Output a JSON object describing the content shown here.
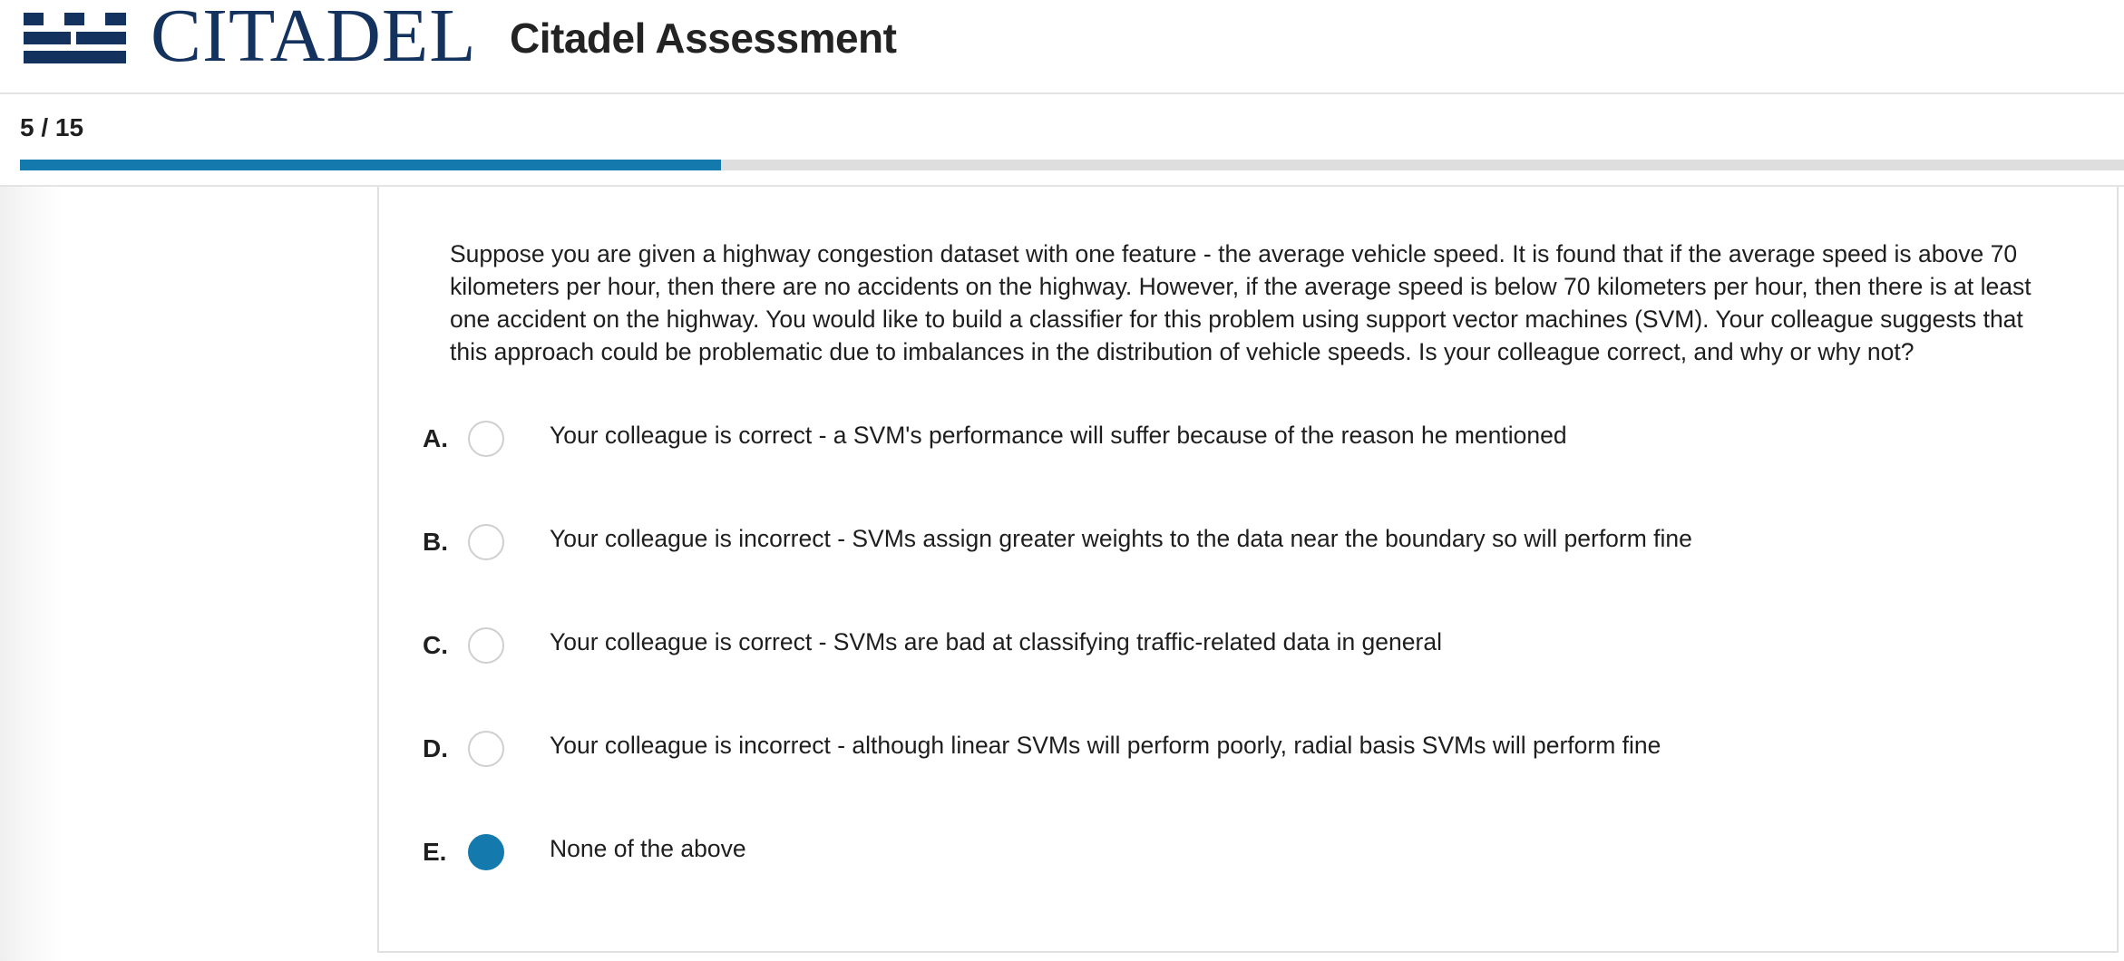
{
  "header": {
    "brand": "CITADEL",
    "title": "Citadel Assessment",
    "brand_color": "#14325e"
  },
  "progress": {
    "counter": "5 / 15",
    "current": 5,
    "total": 15,
    "fill_color": "#1479ad"
  },
  "question": {
    "text": "Suppose you are given a highway congestion dataset with one feature - the average vehicle speed. It is found that if the average speed is above 70 kilometers per hour, then there are no accidents on the highway. However, if the average speed is below 70 kilometers per hour, then there is at least one accident on the highway. You would like to build a classifier for this problem using support vector machines (SVM). Your colleague suggests that this approach could be problematic due to imbalances in the distribution of vehicle speeds. Is your colleague correct, and why or why not?",
    "options": [
      {
        "letter": "A.",
        "text": "Your colleague is correct - a SVM's performance will suffer because of the reason he mentioned",
        "selected": false
      },
      {
        "letter": "B.",
        "text": "Your colleague is incorrect - SVMs assign greater weights to the data near the boundary so will perform fine",
        "selected": false
      },
      {
        "letter": "C.",
        "text": "Your colleague is correct - SVMs are bad at classifying traffic-related data in general",
        "selected": false
      },
      {
        "letter": "D.",
        "text": "Your colleague is incorrect - although linear SVMs will perform poorly, radial basis SVMs will perform fine",
        "selected": false
      },
      {
        "letter": "E.",
        "text": "None of the above",
        "selected": true
      }
    ],
    "selected_color": "#1479ad"
  }
}
